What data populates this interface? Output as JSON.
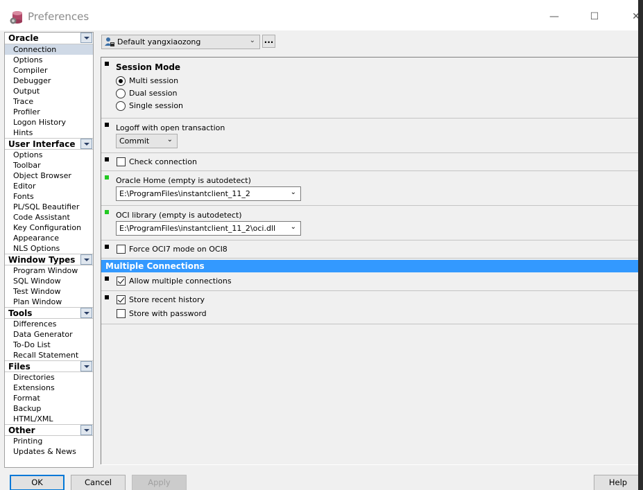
{
  "window": {
    "title": "Preferences",
    "minimize_icon": "minimize-icon",
    "maximize_icon": "maximize-icon",
    "close_icon": "close-icon"
  },
  "nav": {
    "groups": [
      {
        "label": "Oracle",
        "items": [
          "Connection",
          "Options",
          "Compiler",
          "Debugger",
          "Output",
          "Trace",
          "Profiler",
          "Logon History",
          "Hints"
        ]
      },
      {
        "label": "User Interface",
        "items": [
          "Options",
          "Toolbar",
          "Object Browser",
          "Editor",
          "Fonts",
          "PL/SQL Beautifier",
          "Code Assistant",
          "Key Configuration",
          "Appearance",
          "NLS Options"
        ]
      },
      {
        "label": "Window Types",
        "items": [
          "Program Window",
          "SQL Window",
          "Test Window",
          "Plan Window"
        ]
      },
      {
        "label": "Tools",
        "items": [
          "Differences",
          "Data Generator",
          "To-Do List",
          "Recall Statement"
        ]
      },
      {
        "label": "Files",
        "items": [
          "Directories",
          "Extensions",
          "Format",
          "Backup",
          "HTML/XML"
        ]
      },
      {
        "label": "Other",
        "items": [
          "Printing",
          "Updates & News"
        ]
      }
    ],
    "selected": "Connection"
  },
  "profile": {
    "value": "Default yangxiaozong",
    "more_label": "..."
  },
  "settings": {
    "session_mode": {
      "title": "Session Mode",
      "options": [
        "Multi session",
        "Dual session",
        "Single session"
      ],
      "selected": "Multi session"
    },
    "logoff": {
      "label": "Logoff with open transaction",
      "value": "Commit"
    },
    "check_connection": {
      "label": "Check connection",
      "checked": false
    },
    "oracle_home": {
      "label": "Oracle Home (empty is autodetect)",
      "value": "E:\\ProgramFiles\\instantclient_11_2"
    },
    "oci_library": {
      "label": "OCI library (empty is autodetect)",
      "value": "E:\\ProgramFiles\\instantclient_11_2\\oci.dll"
    },
    "force_oci7": {
      "label": "Force OCI7 mode on OCI8",
      "checked": false
    },
    "multiple_connections": {
      "header": "Multiple Connections",
      "allow_multiple": {
        "label": "Allow multiple connections",
        "checked": true
      },
      "store_recent": {
        "label": "Store recent history",
        "checked": true
      },
      "store_password": {
        "label": "Store with password",
        "checked": false
      }
    }
  },
  "buttons": {
    "ok": "OK",
    "cancel": "Cancel",
    "apply": "Apply",
    "help": "Help"
  },
  "colors": {
    "accent": "#3399ff",
    "marker_green": "#22c922"
  }
}
